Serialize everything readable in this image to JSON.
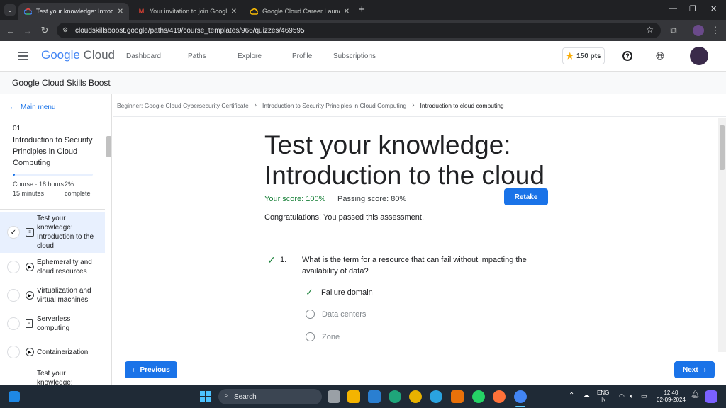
{
  "browser": {
    "tabs": [
      {
        "title": "Test your knowledge: Introducti",
        "active": true,
        "icon": "google-cloud-icon"
      },
      {
        "title": "Your invitation to join Google C",
        "active": false,
        "icon": "gmail-icon"
      },
      {
        "title": "Google Cloud Career Launchpa",
        "active": false,
        "icon": "google-cloud-icon"
      }
    ],
    "new_tab": "+",
    "url": "cloudskillsboost.google/paths/419/course_templates/966/quizzes/469595"
  },
  "header": {
    "logo_google": "Google",
    "logo_cloud": "Cloud",
    "nav": [
      "Dashboard",
      "Paths",
      "Explore",
      "Profile",
      "Subscriptions"
    ],
    "points": "150 pts"
  },
  "skills_boost": {
    "title": "Google Cloud Skills Boost"
  },
  "sidebar": {
    "main_menu": "Main menu",
    "module_number": "01",
    "module_title": "Introduction to Security Principles in Cloud Computing",
    "progress_percent": 2,
    "course_info": "Course · 18 hours",
    "duration": "15 minutes",
    "completion_percent": "2%",
    "completion_label": "complete",
    "items": [
      {
        "label": "Test your knowledge: Introduction to the cloud",
        "type": "quiz",
        "done": true,
        "selected": true
      },
      {
        "label": "Ephemerality and cloud resources",
        "type": "video"
      },
      {
        "label": "Virtualization and virtual machines",
        "type": "video"
      },
      {
        "label": "Serverless computing",
        "type": "document"
      },
      {
        "label": "Containerization",
        "type": "video"
      },
      {
        "label": "Test your knowledge:",
        "type": "quiz"
      }
    ]
  },
  "main": {
    "breadcrumbs": [
      "Beginner: Google Cloud Cybersecurity Certificate",
      "Introduction to Security Principles in Cloud Computing",
      "Introduction to cloud computing"
    ],
    "title_line1": "Test your knowledge:",
    "title_line2": "Introduction to the cloud",
    "your_score": "Your score: 100%",
    "passing_score": "Passing score: 80%",
    "retake": "Retake",
    "congrats": "Congratulations! You passed this assessment.",
    "question": {
      "number": "1.",
      "text": "What is the term for a resource that can fail without impacting the availability of data?",
      "options": [
        {
          "label": "Failure domain",
          "correct": true
        },
        {
          "label": "Data centers",
          "correct": false
        },
        {
          "label": "Zone",
          "correct": false
        }
      ]
    },
    "previous": "Previous",
    "next": "Next"
  },
  "taskbar": {
    "search": "Search",
    "lang_line1": "ENG",
    "lang_line2": "IN",
    "time": "12:40",
    "date": "02-09-2024"
  },
  "colors": {
    "accent": "#1a73e8",
    "success": "#188038",
    "selected_bg": "#e8f0fe"
  }
}
